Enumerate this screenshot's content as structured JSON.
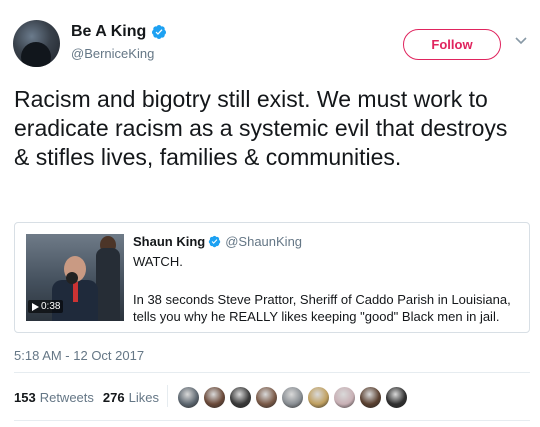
{
  "author": {
    "name": "Be A King",
    "handle": "@BerniceKing",
    "verified": true
  },
  "follow_button": {
    "label": "Follow",
    "color": "#e0245e"
  },
  "tweet": {
    "text": "Racism and bigotry still exist. We must work to eradicate racism as a systemic evil that destroys & stifles lives, families & communities."
  },
  "quoted_tweet": {
    "name": "Shaun King",
    "handle": "@ShaunKing",
    "verified": true,
    "line1": "WATCH.",
    "line2": "In 38 seconds Steve Prattor, Sheriff of Caddo Parish in Louisiana, tells you why he REALLY likes keeping \"good\" Black men in jail.",
    "video_duration": "0:38"
  },
  "timestamp": "5:18 AM - 12 Oct 2017",
  "stats": {
    "retweets_count": "153",
    "retweets_label": "Retweets",
    "likes_count": "276",
    "likes_label": "Likes"
  },
  "likers": [
    {
      "color": "#5d6770"
    },
    {
      "color": "#6b4a3a"
    },
    {
      "color": "#3a3a3a"
    },
    {
      "color": "#7a5a48"
    },
    {
      "color": "#8a8f94"
    },
    {
      "color": "#c0a060"
    },
    {
      "color": "#c8b0b5"
    },
    {
      "color": "#5a4030"
    },
    {
      "color": "#2f2f2f"
    }
  ],
  "colors": {
    "verified_blue": "#1da1f2",
    "secondary_text": "#657786"
  }
}
